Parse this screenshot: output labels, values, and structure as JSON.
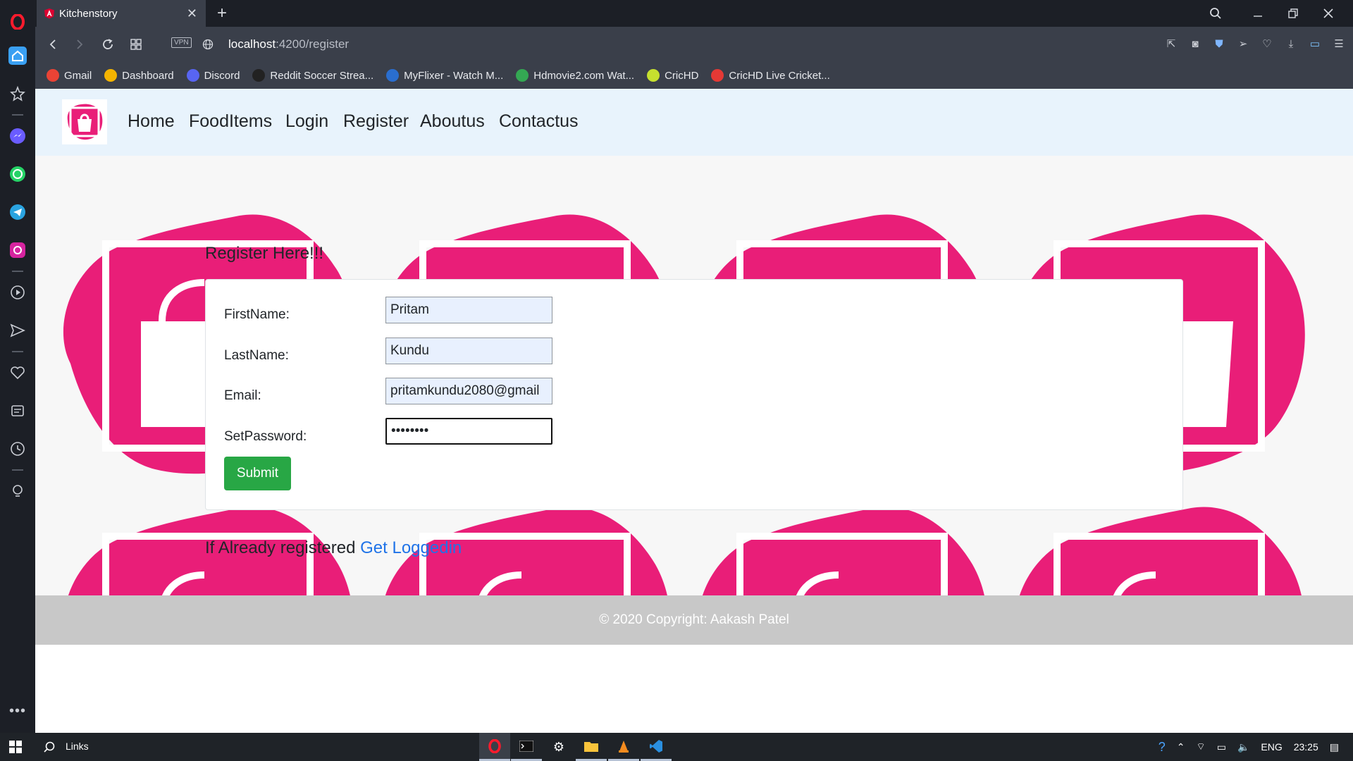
{
  "browser": {
    "tab_title": "Kitchenstory",
    "tab_close": "✕",
    "new_tab": "+",
    "url_host": "localhost",
    "url_path": ":4200/register",
    "vpn_label": "VPN",
    "window_controls": [
      "search-icon",
      "minimize-icon",
      "restore-icon",
      "close-icon"
    ],
    "bookmarks": [
      {
        "label": "Gmail",
        "color": "#ea4335"
      },
      {
        "label": "Dashboard",
        "color": "#f4b400"
      },
      {
        "label": "Discord",
        "color": "#5865f2"
      },
      {
        "label": "Reddit Soccer Strea...",
        "color": "#222222"
      },
      {
        "label": "MyFlixer - Watch M...",
        "color": "#2a6ecf"
      },
      {
        "label": "Hdmovie2.com Wat...",
        "color": "#34a853"
      },
      {
        "label": "CricHD",
        "color": "#c6e02f"
      },
      {
        "label": "CricHD Live Cricket...",
        "color": "#e53935"
      }
    ]
  },
  "app": {
    "nav": {
      "links": [
        "Home",
        "FoodItems",
        "Login",
        "Register",
        "Aboutus",
        "Contactus"
      ]
    },
    "register": {
      "heading": "Register Here!!!",
      "fields": [
        {
          "label": "FirstName:",
          "value": "Pritam"
        },
        {
          "label": "LastName:",
          "value": "Kundu"
        },
        {
          "label": "Email:",
          "value": "pritamkundu2080@gmail"
        },
        {
          "label": "SetPassword:",
          "value": "••••••••"
        }
      ],
      "submit_label": "Submit"
    },
    "already": {
      "text": "If Already registered ",
      "link": "Get Loggedin"
    },
    "footer": "© 2020 Copyright: Aakash Patel",
    "colors": {
      "accent_pink": "#e91e78",
      "submit_green": "#28a745",
      "link_blue": "#1f73e8",
      "nav_bg": "#e8f3fc",
      "footer_bg": "#c8c8c8"
    }
  },
  "taskbar": {
    "search_label": "Links",
    "language": "ENG",
    "time": "23:25"
  }
}
